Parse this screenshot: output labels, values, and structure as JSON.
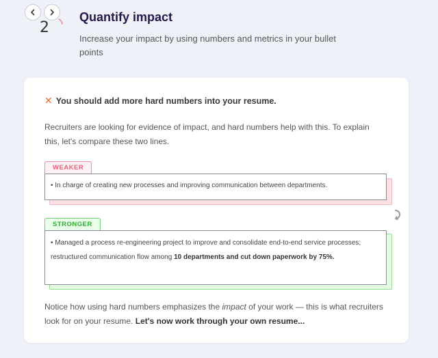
{
  "nav": {
    "prev_icon": "chevron-left-icon",
    "next_icon": "chevron-right-icon"
  },
  "step": {
    "number": "2",
    "accent_color": "#f08aa0"
  },
  "header": {
    "title": "Quantify impact",
    "subtitle": "Increase your impact by using numbers and metrics in your bullet points"
  },
  "card": {
    "warning_icon": "x-icon",
    "warning_color": "#e8692c",
    "warning": "You should add more hard numbers into your resume.",
    "intro": "Recruiters are looking for evidence of impact, and hard numbers help with this. To explain this, let's compare these two lines.",
    "weaker": {
      "label": "WEAKER",
      "text": "• In charge of creating new processes and improving communication between departments."
    },
    "stronger": {
      "label": "STRONGER",
      "text_plain": "• Managed a process re-engineering project to improve and consolidate end-to-end service processes; restructured communication flow among ",
      "text_bold": "10 departments and cut down paperwork by 75%."
    },
    "refresh_icon": "refresh-icon",
    "outro_1": "Notice how using hard numbers emphasizes the ",
    "outro_em": "impact",
    "outro_2": " of your work — this is what recruiters look for on your resume. ",
    "outro_bold": "Let's now work through your own resume..."
  },
  "colors": {
    "background": "#eef1f8",
    "title": "#24194a",
    "weaker": "#e8607c",
    "stronger": "#2fae2f"
  }
}
